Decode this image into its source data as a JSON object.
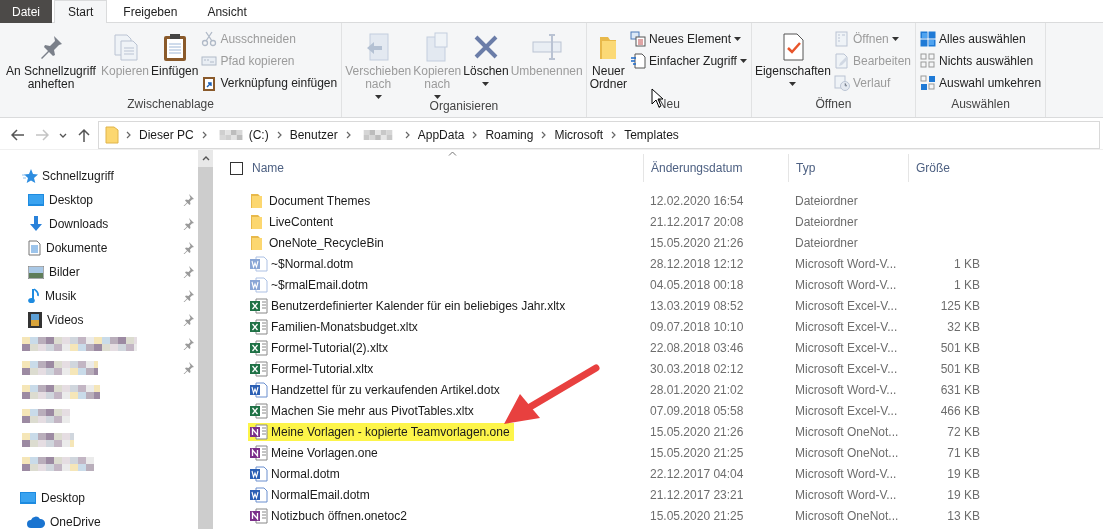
{
  "ribbon_tabs": [
    {
      "label": "Datei",
      "kind": "file",
      "selected": false
    },
    {
      "label": "Start",
      "kind": "tab",
      "selected": true
    },
    {
      "label": "Freigeben",
      "kind": "tab",
      "selected": false
    },
    {
      "label": "Ansicht",
      "kind": "tab",
      "selected": false
    }
  ],
  "ribbon_groups": [
    {
      "label": "Zwischenablage",
      "items": [
        {
          "kind": "large",
          "label": "An Schnellzugriff anheften",
          "disabled": false,
          "dropdown": false
        },
        {
          "kind": "large",
          "label": "Kopieren",
          "disabled": true,
          "dropdown": false
        },
        {
          "kind": "large",
          "label": "Einfügen",
          "disabled": false,
          "dropdown": false
        },
        {
          "kind": "small",
          "label": "Ausschneiden",
          "disabled": true,
          "dropdown": false
        },
        {
          "kind": "small",
          "label": "Pfad kopieren",
          "disabled": true,
          "dropdown": false
        },
        {
          "kind": "small",
          "label": "Verknüpfung einfügen",
          "disabled": false,
          "dropdown": false
        }
      ]
    },
    {
      "label": "Organisieren",
      "items": [
        {
          "kind": "large",
          "label": "Verschieben nach",
          "disabled": true,
          "dropdown": true
        },
        {
          "kind": "large",
          "label": "Kopieren nach",
          "disabled": true,
          "dropdown": true
        },
        {
          "kind": "large",
          "label": "Löschen",
          "disabled": false,
          "dropdown": true
        },
        {
          "kind": "large",
          "label": "Umbenennen",
          "disabled": true,
          "dropdown": false
        }
      ]
    },
    {
      "label": "Neu",
      "items": [
        {
          "kind": "large",
          "label": "Neuer Ordner",
          "disabled": false,
          "dropdown": false
        },
        {
          "kind": "small",
          "label": "Neues Element",
          "disabled": false,
          "dropdown": true
        },
        {
          "kind": "small",
          "label": "Einfacher Zugriff",
          "disabled": false,
          "dropdown": true
        }
      ]
    },
    {
      "label": "Öffnen",
      "items": [
        {
          "kind": "large",
          "label": "Eigenschaften",
          "disabled": false,
          "dropdown": true
        },
        {
          "kind": "small",
          "label": "Öffnen",
          "disabled": true,
          "dropdown": true
        },
        {
          "kind": "small",
          "label": "Bearbeiten",
          "disabled": true,
          "dropdown": false
        },
        {
          "kind": "small",
          "label": "Verlauf",
          "disabled": true,
          "dropdown": false
        }
      ]
    },
    {
      "label": "Auswählen",
      "items": [
        {
          "kind": "small",
          "label": "Alles auswählen",
          "disabled": false,
          "dropdown": false
        },
        {
          "kind": "small",
          "label": "Nichts auswählen",
          "disabled": false,
          "dropdown": false
        },
        {
          "kind": "small",
          "label": "Auswahl umkehren",
          "disabled": false,
          "dropdown": false
        }
      ]
    }
  ],
  "navigation": {
    "back_disabled": false,
    "forward_disabled": true
  },
  "breadcrumb": [
    {
      "kind": "segment",
      "label": "Dieser PC"
    },
    {
      "kind": "segment",
      "label": "(C:)",
      "pixelated_prefix": true
    },
    {
      "kind": "segment",
      "label": "Benutzer"
    },
    {
      "kind": "pixelated"
    },
    {
      "kind": "segment",
      "label": "AppData"
    },
    {
      "kind": "segment",
      "label": "Roaming"
    },
    {
      "kind": "segment",
      "label": "Microsoft"
    },
    {
      "kind": "segment",
      "label": "Templates"
    }
  ],
  "sidebar": {
    "quick_access": {
      "label": "Schnellzugriff",
      "items": [
        {
          "kind": "item",
          "label": "Desktop",
          "pinned": true
        },
        {
          "kind": "item",
          "label": "Downloads",
          "pinned": true
        },
        {
          "kind": "item",
          "label": "Dokumente",
          "pinned": true
        },
        {
          "kind": "item",
          "label": "Bilder",
          "pinned": true
        },
        {
          "kind": "item",
          "label": "Musik",
          "pinned": true
        },
        {
          "kind": "item",
          "label": "Videos",
          "pinned": true
        },
        {
          "kind": "pixelated",
          "pinned": true
        },
        {
          "kind": "pixelated",
          "pinned": true
        },
        {
          "kind": "pixelated",
          "pinned": false
        },
        {
          "kind": "pixelated",
          "pinned": false
        },
        {
          "kind": "pixelated",
          "pinned": false
        },
        {
          "kind": "pixelated",
          "pinned": false
        }
      ]
    },
    "roots": [
      {
        "label": "Desktop"
      },
      {
        "label": "OneDrive"
      }
    ]
  },
  "table": {
    "select_all_checked": false,
    "columns": [
      {
        "label": "Name",
        "sorted": true
      },
      {
        "label": "Änderungsdatum",
        "sorted": false
      },
      {
        "label": "Typ",
        "sorted": false
      },
      {
        "label": "Größe",
        "sorted": false
      }
    ],
    "rows": [
      {
        "kind": "folder",
        "name": "Document Themes",
        "date": "12.02.2020 16:54",
        "type": "Dateiordner",
        "highlighted": false,
        "hidden": false
      },
      {
        "kind": "folder",
        "name": "LiveContent",
        "date": "21.12.2017 20:08",
        "type": "Dateiordner",
        "highlighted": false,
        "hidden": false
      },
      {
        "kind": "folder",
        "name": "OneNote_RecycleBin",
        "date": "15.05.2020 21:26",
        "type": "Dateiordner",
        "highlighted": false,
        "hidden": false
      },
      {
        "kind": "word",
        "name": "~$Normal.dotm",
        "date": "28.12.2018 12:12",
        "type": "Microsoft Word-V...",
        "size": "1 KB",
        "highlighted": false,
        "hidden": true
      },
      {
        "kind": "word",
        "name": "~$rmalEmail.dotm",
        "date": "04.05.2018 00:18",
        "type": "Microsoft Word-V...",
        "size": "1 KB",
        "highlighted": false,
        "hidden": true
      },
      {
        "kind": "excel",
        "name": "Benutzerdefinierter Kalender für ein beliebiges Jahr.xltx",
        "date": "13.03.2019 08:52",
        "type": "Microsoft Excel-V...",
        "size": "125 KB",
        "highlighted": false,
        "hidden": false
      },
      {
        "kind": "excel",
        "name": "Familien-Monatsbudget.xltx",
        "date": "09.07.2018 10:10",
        "type": "Microsoft Excel-V...",
        "size": "32 KB",
        "highlighted": false,
        "hidden": false
      },
      {
        "kind": "excel",
        "name": "Formel-Tutorial(2).xltx",
        "date": "22.08.2018 03:46",
        "type": "Microsoft Excel-V...",
        "size": "501 KB",
        "highlighted": false,
        "hidden": false
      },
      {
        "kind": "excel",
        "name": "Formel-Tutorial.xltx",
        "date": "30.03.2018 02:12",
        "type": "Microsoft Excel-V...",
        "size": "501 KB",
        "highlighted": false,
        "hidden": false
      },
      {
        "kind": "word",
        "name": "Handzettel für zu verkaufenden Artikel.dotx",
        "date": "28.01.2020 21:02",
        "type": "Microsoft Word-V...",
        "size": "631 KB",
        "highlighted": false,
        "hidden": false
      },
      {
        "kind": "excel",
        "name": "Machen Sie mehr aus PivotTables.xltx",
        "date": "07.09.2018 05:58",
        "type": "Microsoft Excel-V...",
        "size": "466 KB",
        "highlighted": false,
        "hidden": false
      },
      {
        "kind": "onenote",
        "name": "Meine Vorlagen - kopierte Teamvorlagen.one",
        "date": "15.05.2020 21:26",
        "type": "Microsoft OneNot...",
        "size": "72 KB",
        "highlighted": true,
        "hidden": false
      },
      {
        "kind": "onenote",
        "name": "Meine Vorlagen.one",
        "date": "15.05.2020 21:25",
        "type": "Microsoft OneNot...",
        "size": "71 KB",
        "highlighted": false,
        "hidden": false
      },
      {
        "kind": "word",
        "name": "Normal.dotm",
        "date": "22.12.2017 04:04",
        "type": "Microsoft Word-V...",
        "size": "19 KB",
        "highlighted": false,
        "hidden": false
      },
      {
        "kind": "word",
        "name": "NormalEmail.dotm",
        "date": "21.12.2017 23:21",
        "type": "Microsoft Word-V...",
        "size": "19 KB",
        "highlighted": false,
        "hidden": false
      },
      {
        "kind": "onenote",
        "name": "Notizbuch öffnen.onetoc2",
        "date": "15.05.2020 21:25",
        "type": "Microsoft OneNot...",
        "size": "13 KB",
        "highlighted": false,
        "hidden": false
      }
    ]
  }
}
